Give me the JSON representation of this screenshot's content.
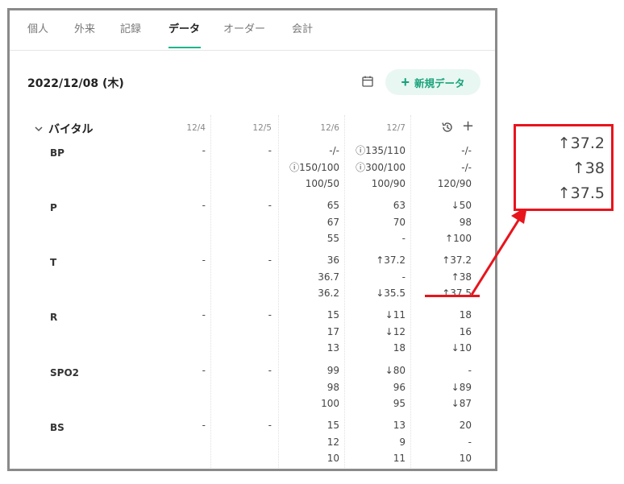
{
  "tabs": [
    {
      "label": "個人"
    },
    {
      "label": "外来"
    },
    {
      "label": "記録"
    },
    {
      "label": "データ"
    },
    {
      "label": "オーダー"
    },
    {
      "label": "会計"
    }
  ],
  "active_tab": "データ",
  "header": {
    "date": "2022/12/08 (木)",
    "new_button_label": "新規データ",
    "new_button_icon": "plus-icon",
    "calendar_icon": "calendar-icon"
  },
  "section": {
    "title": "バイタル",
    "columns": [
      "12/4",
      "12/5",
      "12/6",
      "12/7"
    ],
    "history_icon": "history-icon",
    "add_icon": "plus-icon"
  },
  "rows": [
    {
      "label": "BP",
      "cells": [
        [
          "-"
        ],
        [
          "-"
        ],
        [
          "-/-",
          "ⓘ150/100",
          "100/50"
        ],
        [
          "ⓘ135/110",
          "ⓘ300/100",
          "100/90"
        ],
        [
          "-/-",
          "-/-",
          "120/90"
        ]
      ]
    },
    {
      "label": "P",
      "cells": [
        [
          "-"
        ],
        [
          "-"
        ],
        [
          "65",
          "67",
          "55"
        ],
        [
          "63",
          "70",
          "-"
        ],
        [
          "↓50",
          "98",
          "↑100"
        ]
      ]
    },
    {
      "label": "T",
      "cells": [
        [
          "-"
        ],
        [
          "-"
        ],
        [
          "36",
          "36.7",
          "36.2"
        ],
        [
          "↑37.2",
          "-",
          "↓35.5"
        ],
        [
          "↑37.2",
          "↑38",
          "↑37.5"
        ]
      ]
    },
    {
      "label": "R",
      "cells": [
        [
          "-"
        ],
        [
          "-"
        ],
        [
          "15",
          "17",
          "13"
        ],
        [
          "↓11",
          "↓12",
          "18"
        ],
        [
          "18",
          "16",
          "↓10"
        ]
      ]
    },
    {
      "label": "SPO2",
      "cells": [
        [
          "-"
        ],
        [
          "-"
        ],
        [
          "99",
          "98",
          "100"
        ],
        [
          "↓80",
          "96",
          "95"
        ],
        [
          "-",
          "↓89",
          "↓87"
        ]
      ]
    },
    {
      "label": "BS",
      "cells": [
        [
          "-"
        ],
        [
          "-"
        ],
        [
          "15",
          "12",
          "10"
        ],
        [
          "13",
          "9",
          "11"
        ],
        [
          "20",
          "-",
          "10"
        ]
      ]
    }
  ],
  "callout": {
    "values": [
      "↑37.2",
      "↑38",
      "↑37.5"
    ],
    "highlight_color": "#e8141c"
  },
  "colors": {
    "accent": "#1fb58a",
    "accent_bg": "#e8f7f1",
    "annotation": "#e8141c"
  }
}
